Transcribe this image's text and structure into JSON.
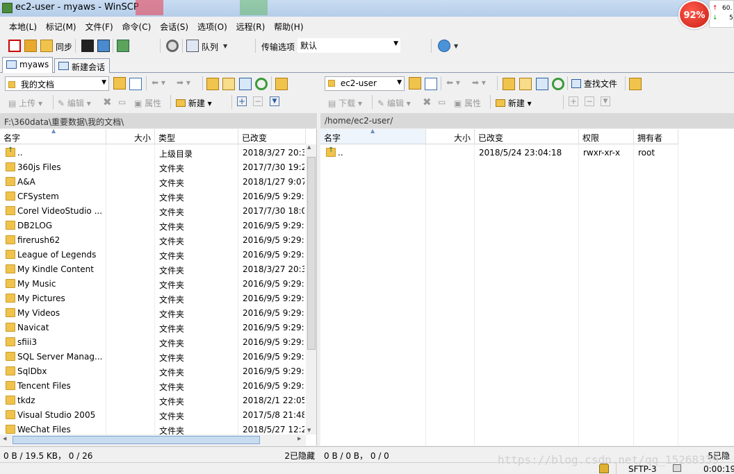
{
  "window": {
    "title": "ec2-user - myaws - WinSCP"
  },
  "widget": {
    "percent": "92%",
    "net_up": "60.",
    "net_down": "5"
  },
  "menu": [
    "本地(L)",
    "标记(M)",
    "文件(F)",
    "命令(C)",
    "会话(S)",
    "选项(O)",
    "远程(R)",
    "帮助(H)"
  ],
  "toolbar": {
    "sync": "同步",
    "queue": "队列",
    "transfer_options_label": "传输选项",
    "transfer_preset": "默认"
  },
  "tabs": {
    "session": "myaws",
    "new_session": "新建会话"
  },
  "left": {
    "location": "我的文档",
    "actions": {
      "upload": "上传",
      "edit": "编辑",
      "properties": "属性",
      "new": "新建"
    },
    "path": "F:\\360data\\重要数据\\我的文档\\",
    "columns": {
      "name": "名字",
      "size": "大小",
      "type": "类型",
      "modified": "已改变"
    },
    "rows": [
      {
        "name": "..",
        "type": "上级目录",
        "modified": "2018/3/27  20:3"
      },
      {
        "name": "360js Files",
        "type": "文件夹",
        "modified": "2017/7/30  19:2"
      },
      {
        "name": "A&A",
        "type": "文件夹",
        "modified": "2018/1/27  9:07"
      },
      {
        "name": "CFSystem",
        "type": "文件夹",
        "modified": "2016/9/5  9:29:"
      },
      {
        "name": "Corel VideoStudio ...",
        "type": "文件夹",
        "modified": "2017/7/30  18:0"
      },
      {
        "name": "DB2LOG",
        "type": "文件夹",
        "modified": "2016/9/5  9:29:"
      },
      {
        "name": "firerush62",
        "type": "文件夹",
        "modified": "2016/9/5  9:29:"
      },
      {
        "name": "League of Legends",
        "type": "文件夹",
        "modified": "2016/9/5  9:29:"
      },
      {
        "name": "My Kindle Content",
        "type": "文件夹",
        "modified": "2018/3/27  20:3"
      },
      {
        "name": "My Music",
        "type": "文件夹",
        "modified": "2016/9/5  9:29:"
      },
      {
        "name": "My Pictures",
        "type": "文件夹",
        "modified": "2016/9/5  9:29:"
      },
      {
        "name": "My Videos",
        "type": "文件夹",
        "modified": "2016/9/5  9:29:"
      },
      {
        "name": "Navicat",
        "type": "文件夹",
        "modified": "2016/9/5  9:29:"
      },
      {
        "name": "sfiii3",
        "type": "文件夹",
        "modified": "2016/9/5  9:29:"
      },
      {
        "name": "SQL Server Manag...",
        "type": "文件夹",
        "modified": "2016/9/5  9:29:"
      },
      {
        "name": "SqlDbx",
        "type": "文件夹",
        "modified": "2016/9/5  9:29:"
      },
      {
        "name": "Tencent Files",
        "type": "文件夹",
        "modified": "2016/9/5  9:29:"
      },
      {
        "name": "tkdz",
        "type": "文件夹",
        "modified": "2018/2/1  22:05"
      },
      {
        "name": "Visual Studio 2005",
        "type": "文件夹",
        "modified": "2017/5/8  21:48"
      },
      {
        "name": "WeChat Files",
        "type": "文件夹",
        "modified": "2018/5/27  12:2"
      }
    ],
    "status": "0 B / 19.5 KB， 0 / 26",
    "hidden": "2已隐藏"
  },
  "right": {
    "location": "ec2-user",
    "find_files": "查找文件",
    "actions": {
      "download": "下载",
      "edit": "编辑",
      "properties": "属性",
      "new": "新建"
    },
    "path": "/home/ec2-user/",
    "columns": {
      "name": "名字",
      "size": "大小",
      "modified": "已改变",
      "permissions": "权限",
      "owner": "拥有者"
    },
    "rows": [
      {
        "name": "..",
        "modified": "2018/5/24 23:04:18",
        "permissions": "rwxr-xr-x",
        "owner": "root"
      }
    ],
    "status": "0 B / 0 B， 0 / 0",
    "hidden": "5已隐"
  },
  "statusbar": {
    "protocol": "SFTP-3",
    "time": "0:00:19"
  },
  "watermark": "https://blog.csdn.net/qq_15268339"
}
